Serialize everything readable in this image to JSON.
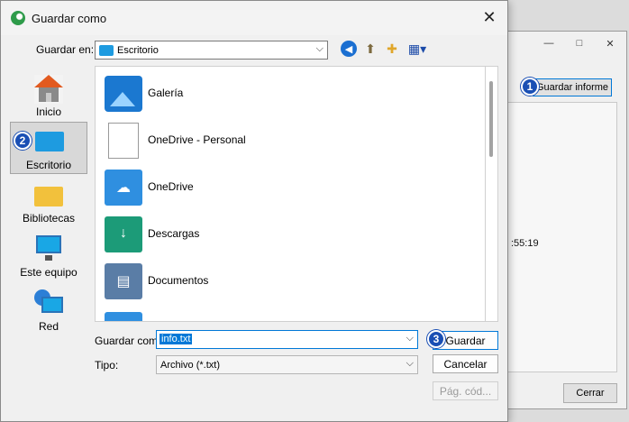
{
  "background_window": {
    "report_button": "Guardar informe",
    "time_fragment": ":55:19",
    "close_button": "Cerrar",
    "controls": [
      "—",
      "□",
      "✕"
    ]
  },
  "dialog": {
    "title": "Guardar como",
    "close_glyph": "✕",
    "save_in_label": "Guardar en:",
    "save_in_value": "Escritorio",
    "places": [
      {
        "label": "Inicio",
        "icon": "home-icon"
      },
      {
        "label": "Escritorio",
        "icon": "desktop-icon",
        "selected": true
      },
      {
        "label": "Bibliotecas",
        "icon": "libraries-icon"
      },
      {
        "label": "Este equipo",
        "icon": "this-pc-icon"
      },
      {
        "label": "Red",
        "icon": "network-icon"
      }
    ],
    "files": [
      {
        "label": "Galería",
        "icon": "gallery-icon"
      },
      {
        "label": "OneDrive - Personal",
        "icon": "document-icon"
      },
      {
        "label": "OneDrive",
        "icon": "onedrive-folder-icon"
      },
      {
        "label": "Descargas",
        "icon": "downloads-folder-icon"
      },
      {
        "label": "Documentos",
        "icon": "documents-folder-icon"
      }
    ],
    "filename_label": "Guardar como",
    "filename_value": "info.txt",
    "type_label": "Tipo:",
    "type_value": "Archivo (*.txt)",
    "save_button": "Guardar",
    "cancel_button": "Cancelar",
    "codepage_button": "Pág. cód..."
  },
  "annotations": [
    "1",
    "2",
    "3"
  ],
  "colors": {
    "accent": "#0078d7",
    "badge": "#1a4fb4"
  }
}
